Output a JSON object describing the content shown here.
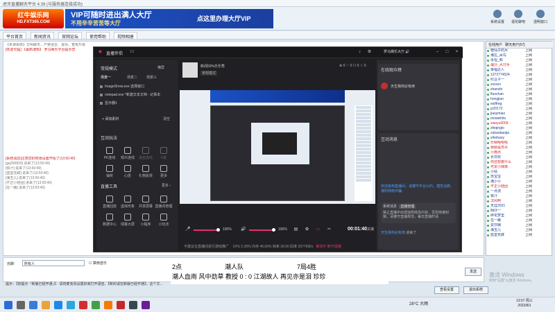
{
  "host": {
    "window_title": "虎牙直播聊天平台 4.39 (与服务器连接成功)",
    "logo_text": "红牛娱乐网",
    "logo_sub": "HD.FXT365.COM",
    "ad1_line1": "VIP可随时进出满人大厅",
    "ad1_line2": "不用辛辛苦苦等大厅",
    "ad2_text": "点这里办理大厅VIP",
    "tools": [
      "系统设置",
      "语花聊吧",
      "透明窗口"
    ],
    "tabs": [
      "平台首页",
      "新闻资讯",
      "官网论坛",
      "使用帮助",
      "视频相册"
    ],
    "user_tabs": [
      "在线用户",
      "聊天用户[57]"
    ],
    "chat_lines": [
      {
        "text": "【未读系统】文明聊天，严禁谣言、谩骂，宽免升级",
        "red": false
      },
      {
        "text": "[欢迎光临] 【最新通知】 罗马娱乐平台提示您",
        "red": true
      },
      {
        "text": "[系统消息]注意您的权限设置开始了(13:50:40)",
        "red": true
      },
      {
        "text": "[gq250820] 进来了(13:50:40)",
        "red": false
      },
      {
        "text": "[铁汁] 进来了(13:50:40)",
        "red": false
      },
      {
        "text": "[蓝堂花碟] 进来了(13:50:40)",
        "red": false
      },
      {
        "text": "[海玉儿] 进来了(13:50:40)",
        "red": false
      },
      {
        "text": "[不正小娃团] 进来了(13:50:40)",
        "red": false
      },
      {
        "text": "[在一路] 进来了(13:50:40)",
        "red": false
      }
    ],
    "users": [
      {
        "name": "橙仙子的月",
        "status": "上网",
        "red": false
      },
      {
        "name": "潮左_百鸟",
        "status": "上网",
        "red": false
      },
      {
        "name": "永恒_知",
        "status": "上网",
        "red": false
      },
      {
        "name": "漏沙_大只手",
        "status": "上网",
        "red": true
      },
      {
        "name": "幸福达人",
        "status": "上网",
        "red": false
      },
      {
        "name": "1372774524",
        "status": "上网",
        "red": false
      },
      {
        "name": "红豆子一",
        "status": "上网",
        "red": false
      },
      {
        "name": "xxxxxx",
        "status": "上网",
        "red": false
      },
      {
        "name": "shanshi",
        "status": "上网",
        "red": false
      },
      {
        "name": "fluochan",
        "status": "上网",
        "red": false
      },
      {
        "name": "hongjiao",
        "status": "上网",
        "red": false
      },
      {
        "name": "wuffreg",
        "status": "上网",
        "red": false
      },
      {
        "name": "jz20172",
        "status": "上网",
        "red": false
      },
      {
        "name": "jiaoymiao",
        "status": "上网",
        "red": false
      },
      {
        "name": "mowwhits",
        "status": "上网",
        "red": false
      },
      {
        "name": "xiaoyu0009",
        "status": "上网",
        "red": true
      },
      {
        "name": "zhiqinglo",
        "status": "上网",
        "red": false
      },
      {
        "name": "zubaobaojia",
        "status": "上网",
        "red": false
      },
      {
        "name": "xihebaoy",
        "status": "上网",
        "red": false
      },
      {
        "name": "乐晴哈哈哈",
        "status": "上网",
        "red": true
      },
      {
        "name": "我就是苏丹",
        "status": "上网",
        "red": true
      },
      {
        "name": "小雨点",
        "status": "上网",
        "red": true
      },
      {
        "name": "长日欢",
        "status": "上网",
        "red": false
      },
      {
        "name": "你还想要什么",
        "status": "上网",
        "red": true
      },
      {
        "name": "可爱小妹妹",
        "status": "上网",
        "red": true
      },
      {
        "name": "小倩",
        "status": "上网",
        "red": false
      },
      {
        "name": "苏宝宝",
        "status": "上网",
        "red": false
      },
      {
        "name": "潮小小",
        "status": "上网",
        "red": false
      },
      {
        "name": "不正小娃团",
        "status": "上网",
        "red": true
      },
      {
        "name": "一点流",
        "status": "上网",
        "red": false
      },
      {
        "name": "铁汁",
        "status": "上网",
        "red": false
      },
      {
        "name": "汉风啊",
        "status": "上网",
        "red": true
      },
      {
        "name": "天涯2021",
        "status": "上网",
        "red": false
      },
      {
        "name": "翔仔一",
        "status": "上网",
        "red": false
      },
      {
        "name": "碎花梦里",
        "status": "上网",
        "red": false
      },
      {
        "name": "在一路",
        "status": "上网",
        "red": false
      },
      {
        "name": "爱莎娘",
        "status": "上网",
        "red": false
      },
      {
        "name": "海玉儿",
        "status": "上网",
        "red": false
      },
      {
        "name": "蓝堂花碟",
        "status": "上网",
        "red": false
      }
    ],
    "input_label": "完聊:",
    "input_value": "所有人",
    "sound_check": "禁用音乐",
    "status_line": "提示：【初提示『新版已经开通』】：请将麦克风设置好来打开语音，【新的请在新版已经开通】；这个文...",
    "send_label": "发送",
    "buttons": [
      "查看设置",
      "退出系统"
    ],
    "watermark_1": "激活 Windows",
    "watermark_2": "转到\"设置\"以激活 Windows。"
  },
  "song": {
    "line1_a": "2点",
    "line1_b": "潮人队",
    "line1_c": "7局4胜",
    "line2": "潮人血雨  风中劲草  教授   0 :   0   江湖故人  再见亦是泪  珍珍"
  },
  "taskbar": {
    "weather": "28°C 大雨",
    "time": "13:57 周三",
    "date": "2023/8/1"
  },
  "live": {
    "app_title": "直播伴侣",
    "version": "V3",
    "account": "罗马娱乐大厅 🔊",
    "mode_label": "常规模式",
    "mode_toggle": "横屏",
    "scene_label": "场景一",
    "scene_tabs": [
      "场景二",
      "场景三"
    ],
    "sources": [
      "ImageShow.exe 选择窗口",
      "notepad.exe *新建文本文档 - 记事本",
      "显示器1"
    ],
    "add_source": "+ 添加素材",
    "add_source_right": "清空",
    "interact_title": "互动玩法",
    "interact_items": [
      "PK连线",
      "观众连线",
      "语音连线",
      "K歌",
      "抽奖",
      "心愿",
      "礼物投票",
      "更多"
    ],
    "tools_title": "直播工具",
    "tools_more": "更多 ›",
    "tool_items": [
      "直播回放",
      "虚拟形象",
      "共享屏幕",
      "直播间管理",
      "数据中心",
      "绿幕大屏",
      "小程序",
      "小玩法"
    ],
    "preview_name": "新闻50%乐乐秀",
    "preview_tag": "常规模式",
    "stats": "⊕ 0    ♡ 0    ☐ 0    ☆ 0",
    "vol1": "100%",
    "vol2": "100%",
    "timer": "00:01:40",
    "timer_sub": "关播",
    "footer": "不建议在直播间进行游戏推广",
    "footer_stats": "CPU 2.30%   内存 46.00%   帧率 30.00   码率 2977KB/s",
    "footer_red": "推流中 断开直播",
    "anchor_box_title": "在线观众榜",
    "anchor_name": "天生我材必有用",
    "notice": "欢迎来到直播间，请遵守平台公约，理性消费，谨防网络诈骗。",
    "msg_box_title": "互动消息",
    "msg_user": "系统消息",
    "msg_btn": "直播管理",
    "msg_text": "禁止直播中出现违规低俗内容，否则将被封禁。请遵守直播规范，每日直播时请",
    "welcome_user": "天生我材必有用",
    "welcome_text": "进来了"
  }
}
